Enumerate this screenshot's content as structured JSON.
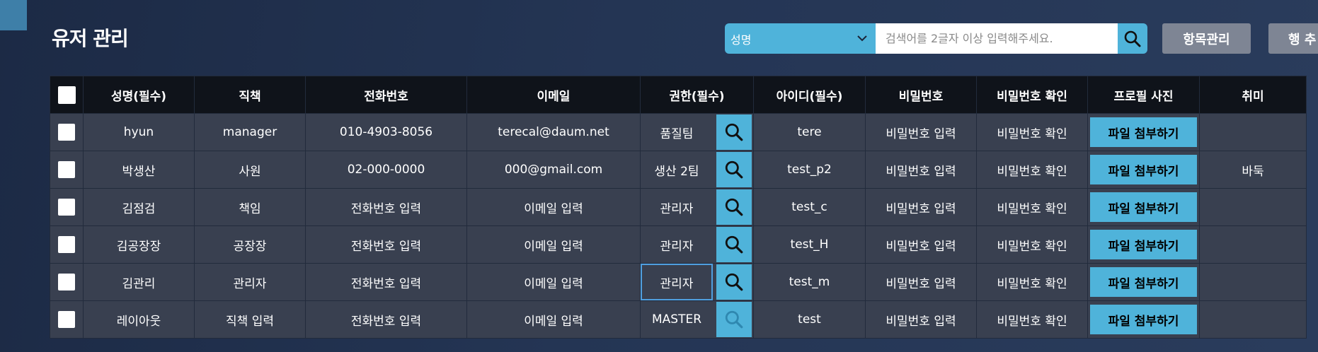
{
  "page": {
    "title": "유저 관리"
  },
  "search": {
    "field_select": "성명",
    "placeholder": "검색어를 2글자 이상 입력해주세요.",
    "value": ""
  },
  "toolbar": {
    "manage_columns": "항목관리",
    "add_row": "행 추"
  },
  "table": {
    "headers": [
      "성명(필수)",
      "직책",
      "전화번호",
      "이메일",
      "권한(필수)",
      "아이디(필수)",
      "비밀번호",
      "비밀번호 확인",
      "프로필 사진",
      "취미"
    ],
    "file_button_label": "파일 첨부하기",
    "rows": [
      {
        "name": "hyun",
        "position": "manager",
        "phone": "010-4903-8056",
        "email": "terecal@daum.net",
        "auth": "품질팀",
        "id": "tere",
        "password": "비밀번호 입력",
        "password_confirm": "비밀번호 확인",
        "hobby": ""
      },
      {
        "name": "박생산",
        "position": "사원",
        "phone": "02-000-0000",
        "email": "000@gmail.com",
        "auth": "생산 2팀",
        "id": "test_p2",
        "password": "비밀번호 입력",
        "password_confirm": "비밀번호 확인",
        "hobby": "바둑"
      },
      {
        "name": "김점검",
        "position": "책임",
        "phone": "전화번호 입력",
        "email": "이메일 입력",
        "auth": "관리자",
        "id": "test_c",
        "password": "비밀번호 입력",
        "password_confirm": "비밀번호 확인",
        "hobby": ""
      },
      {
        "name": "김공장장",
        "position": "공장장",
        "phone": "전화번호 입력",
        "email": "이메일 입력",
        "auth": "관리자",
        "id": "test_H",
        "password": "비밀번호 입력",
        "password_confirm": "비밀번호 확인",
        "hobby": ""
      },
      {
        "name": "김관리",
        "position": "관리자",
        "phone": "전화번호 입력",
        "email": "이메일 입력",
        "auth": "관리자",
        "id": "test_m",
        "password": "비밀번호 입력",
        "password_confirm": "비밀번호 확인",
        "hobby": ""
      },
      {
        "name": "레이아웃",
        "position": "직책 입력",
        "phone": "전화번호 입력",
        "email": "이메일 입력",
        "auth": "MASTER",
        "id": "test",
        "password": "비밀번호 입력",
        "password_confirm": "비밀번호 확인",
        "hobby": ""
      }
    ]
  },
  "colors": {
    "accent": "#4fb3da",
    "header_bg": "#0f131a",
    "row_bg": "#394050",
    "placeholder": "#858b96"
  },
  "icons": [
    "search-icon",
    "chevron-down-icon",
    "checkbox-icon"
  ]
}
